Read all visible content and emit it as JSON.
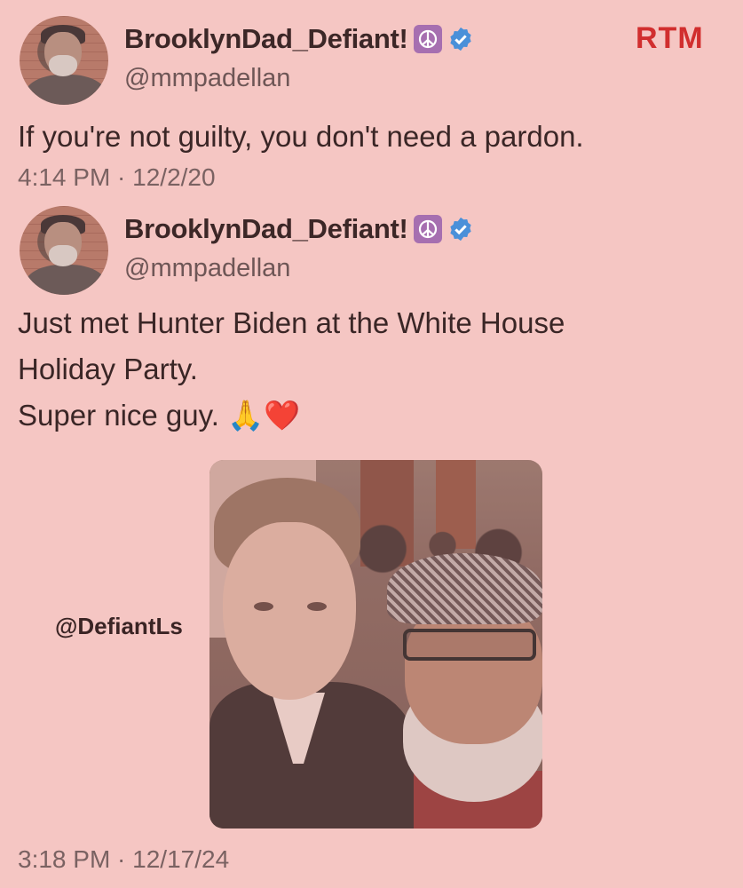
{
  "brand": {
    "logo_text": "RTM",
    "color": "#d12e2e"
  },
  "watermark": "@DefiantLs",
  "tweets": [
    {
      "display_name": "BrooklynDad_Defiant!",
      "name_emoji": "☮",
      "verified_icon": "verified-badge-icon",
      "handle": "@mmpadellan",
      "text_lines": [
        "If you're not guilty, you don't need a pardon."
      ],
      "timestamp": "4:14 PM · 12/2/20"
    },
    {
      "display_name": "BrooklynDad_Defiant!",
      "name_emoji": "☮",
      "verified_icon": "verified-badge-icon",
      "handle": "@mmpadellan",
      "text_lines": [
        "Just met Hunter Biden at the White House",
        "Holiday Party.",
        "Super nice guy. 🙏❤️"
      ],
      "timestamp": "3:18 PM · 12/17/24"
    }
  ],
  "colors": {
    "background": "#f5c6c3",
    "verified": "#4a90d9",
    "peace_bg": "#a66fb0"
  }
}
